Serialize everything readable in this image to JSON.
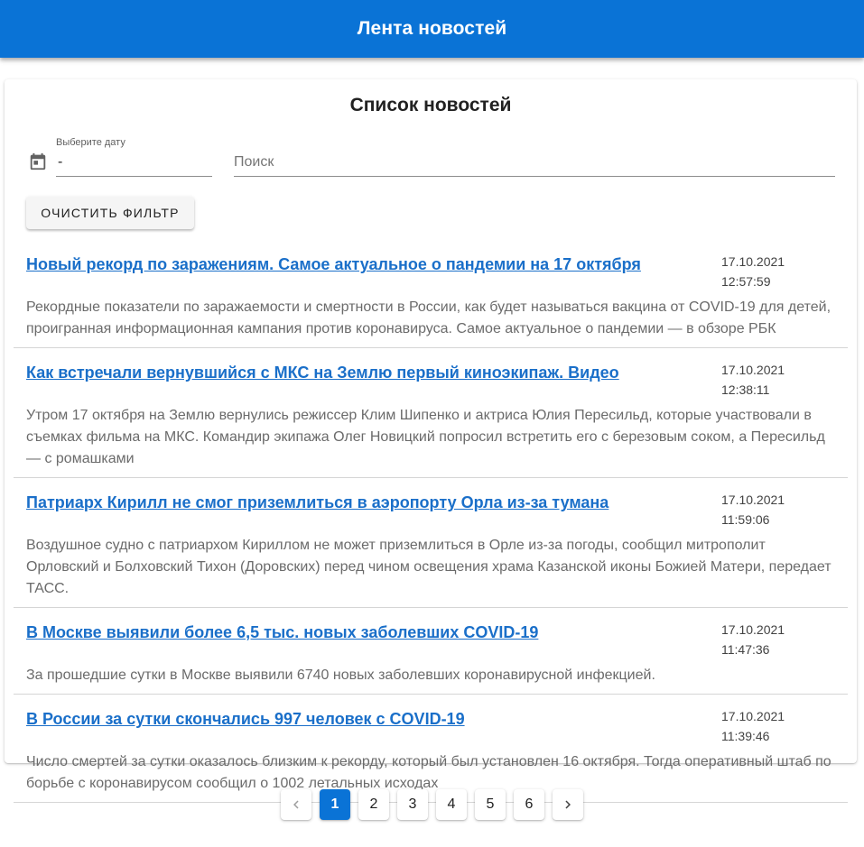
{
  "appbar": {
    "title": "Лента новостей"
  },
  "card": {
    "title": "Список новостей"
  },
  "filters": {
    "date_label": "Выберите дату",
    "date_value": "-",
    "search_placeholder": "Поиск",
    "search_value": "",
    "clear_button_label": "ОЧИСТИТЬ ФИЛЬТР"
  },
  "news": [
    {
      "title": "Новый рекорд по заражениям. Самое актуальное о пандемии на 17 октября",
      "date": "17.10.2021",
      "time": "12:57:59",
      "description": "Рекордные показатели по заражаемости и смертности в России, как будет называться вакцина от COVID-19 для детей, проигранная информационная кампания против коронавируса. Самое актуальное о пандемии — в обзоре РБК"
    },
    {
      "title": "Как встречали вернувшийся с МКС на Землю первый киноэкипаж. Видео",
      "date": "17.10.2021",
      "time": "12:38:11",
      "description": "Утром 17 октября на Землю вернулись режиссер Клим Шипенко и актриса Юлия Пересильд, которые участвовали в съемках фильма на МКС. Командир экипажа Олег Новицкий попросил встретить его с березовым соком, а Пересильд — с ромашками"
    },
    {
      "title": "Патриарх Кирилл не смог приземлиться в аэропорту Орла из-за тумана",
      "date": "17.10.2021",
      "time": "11:59:06",
      "description": "Воздушное судно с патриархом Кириллом не может приземлиться в Орле из-за погоды, сообщил митрополит Орловский и Болховский Тихон (Доровских) перед чином освещения храма Казанской иконы Божией Матери, передает ТАСС."
    },
    {
      "title": "В Москве выявили более 6,5 тыс. новых заболевших COVID-19",
      "date": "17.10.2021",
      "time": "11:47:36",
      "description": "За прошедшие сутки в Москве выявили 6740 новых заболевших коронавирусной инфекцией."
    },
    {
      "title": "В России за сутки скончались 997 человек с COVID-19",
      "date": "17.10.2021",
      "time": "11:39:46",
      "description": "Число смертей за сутки оказалось близким к рекорду, который был установлен 16 октября. Тогда оперативный штаб по борьбе с коронавирусом сообщил о 1002 летальных исходах"
    }
  ],
  "pagination": {
    "prev_icon": "chevron-left-icon",
    "next_icon": "chevron-right-icon",
    "current_page": "1",
    "pages": [
      "1",
      "2",
      "3",
      "4",
      "5",
      "6"
    ]
  },
  "colors": {
    "primary": "#0a73d6",
    "link": "#1a6fc9"
  }
}
